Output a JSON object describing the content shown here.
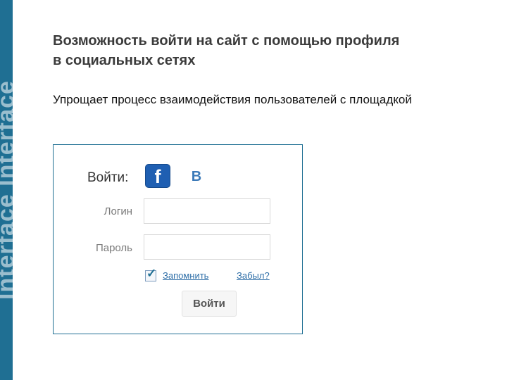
{
  "decoration": {
    "side_band_color": "#1f6f93",
    "side_band_text": "Interface Interface"
  },
  "slide": {
    "title_line1": "Возможность войти на сайт с помощью профиля",
    "title_line2": "в социальных сетях",
    "subtitle": "Упрощает процесс взаимодействия пользователей с площадкой"
  },
  "login_form": {
    "heading": "Войти:",
    "social": {
      "facebook_glyph": "f",
      "facebook_icon": "facebook-icon",
      "vk_glyph": "В",
      "vk_icon": "vk-icon",
      "facebook_color": "#1f5fb2",
      "vk_color": "#3c7ab8"
    },
    "login_label": "Логин",
    "login_value": "",
    "password_label": "Пароль",
    "password_value": "",
    "remember_checked": true,
    "remember_label": "Запомнить",
    "forgot_label": "Забыл?",
    "submit_label": "Войти"
  }
}
